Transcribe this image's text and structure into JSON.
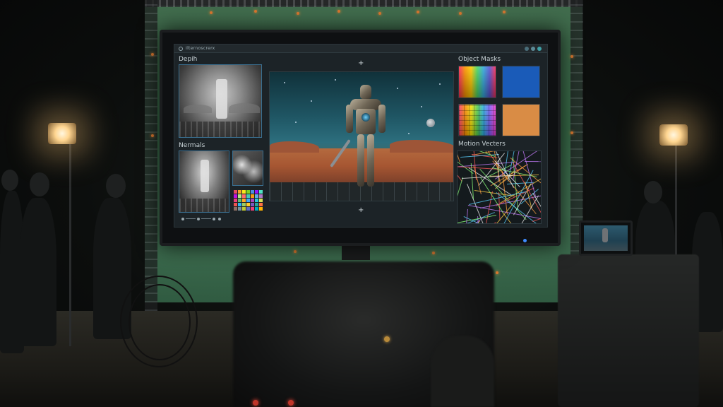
{
  "app": {
    "title": "Ilternoscrerx"
  },
  "panels": {
    "depth": {
      "label": "Depih"
    },
    "normals": {
      "label": "Nermals"
    },
    "object_masks": {
      "label": "Object Masks",
      "tiles": [
        {
          "name": "rainbow-mask",
          "kind": "gradient"
        },
        {
          "name": "blue-mask",
          "color": "#1a5bb8"
        },
        {
          "name": "grid-mask",
          "kind": "gradient-grid"
        },
        {
          "name": "orange-mask",
          "color": "#d98c45"
        }
      ]
    },
    "motion_vectors": {
      "label": "Motion Vecters"
    }
  },
  "viewport": {
    "crosshair_top": "+",
    "crosshair_bottom": "+"
  },
  "colors": {
    "accent_border": "#3a6f90",
    "panel_bg": "#1c2327",
    "window_controls": [
      "#4a6e7a",
      "#5c8a96",
      "#3fa2a8"
    ]
  },
  "icons": [
    "app-icon",
    "play-icon",
    "window-control-icon"
  ]
}
